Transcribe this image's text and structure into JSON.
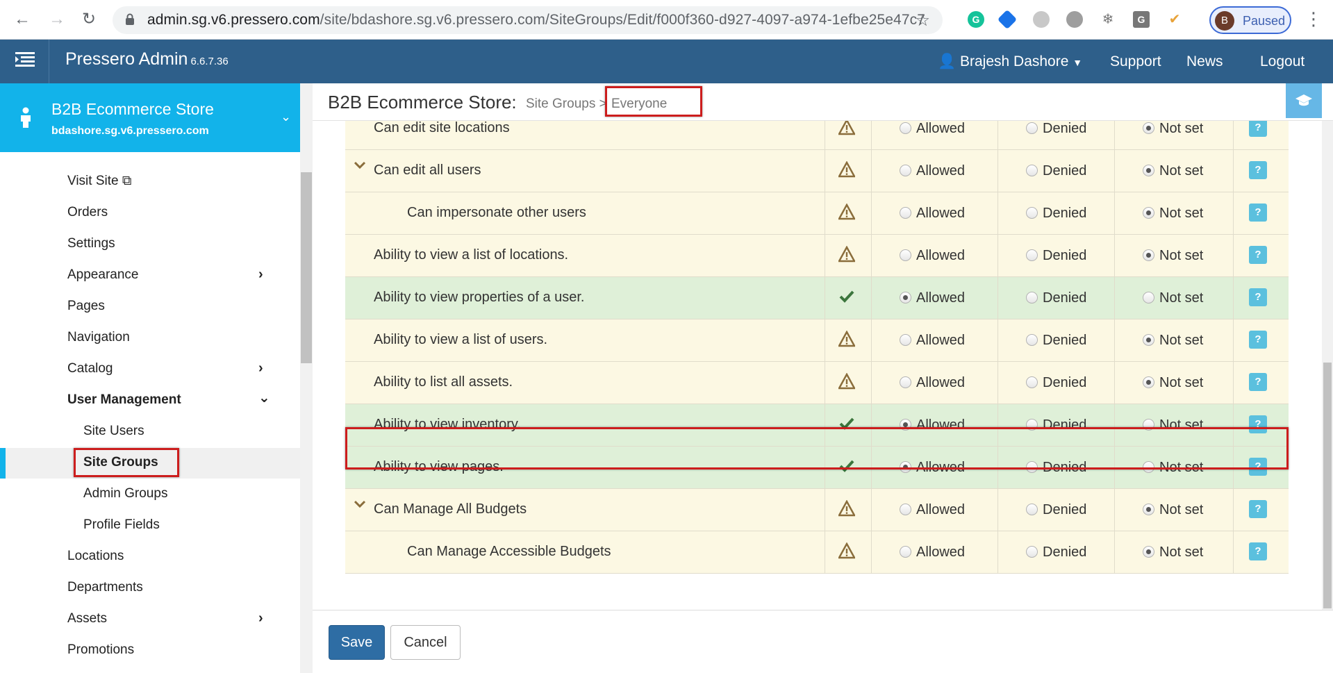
{
  "browser": {
    "url_host": "admin.sg.v6.pressero.com",
    "url_path": "/site/bdashore.sg.v6.pressero.com/SiteGroups/Edit/f000f360-d927-4097-a974-1efbe25e47c7",
    "profile_initial": "B",
    "profile_status": "Paused"
  },
  "header": {
    "brand": "Pressero Admin",
    "version": "6.6.7.36",
    "user": "Brajesh Dashore",
    "nav": [
      "Support",
      "News",
      "Logout"
    ]
  },
  "store": {
    "name": "B2B Ecommerce Store",
    "domain": "bdashore.sg.v6.pressero.com"
  },
  "sidebar": {
    "items": [
      {
        "label": "Visit Site"
      },
      {
        "label": "Orders"
      },
      {
        "label": "Settings"
      },
      {
        "label": "Appearance"
      },
      {
        "label": "Pages"
      },
      {
        "label": "Navigation"
      },
      {
        "label": "Catalog"
      },
      {
        "label": "User Management"
      },
      {
        "label": "Site Users"
      },
      {
        "label": "Site Groups"
      },
      {
        "label": "Admin Groups"
      },
      {
        "label": "Profile Fields"
      },
      {
        "label": "Locations"
      },
      {
        "label": "Departments"
      },
      {
        "label": "Assets"
      },
      {
        "label": "Promotions"
      }
    ]
  },
  "content": {
    "title": "B2B Ecommerce Store:",
    "breadcrumb": "Site Groups",
    "separator": ">",
    "current": "Everyone"
  },
  "options": {
    "allowed": "Allowed",
    "denied": "Denied",
    "notset": "Not set",
    "help": "?"
  },
  "permissions": [
    {
      "label": "Can edit site locations",
      "state": "notset",
      "status": "warn"
    },
    {
      "label": "Can edit all users",
      "state": "notset",
      "status": "warn"
    },
    {
      "label": "Can impersonate other users",
      "state": "notset",
      "status": "warn"
    },
    {
      "label": "Ability to view a list of locations.",
      "state": "notset",
      "status": "warn"
    },
    {
      "label": "Ability to view properties of a user.",
      "state": "allowed",
      "status": "ok"
    },
    {
      "label": "Ability to view a list of users.",
      "state": "notset",
      "status": "warn"
    },
    {
      "label": "Ability to list all assets.",
      "state": "notset",
      "status": "warn"
    },
    {
      "label": "Ability to view inventory.",
      "state": "allowed",
      "status": "ok"
    },
    {
      "label": "Ability to view pages.",
      "state": "allowed",
      "status": "ok"
    },
    {
      "label": "Can Manage All Budgets",
      "state": "notset",
      "status": "warn"
    },
    {
      "label": "Can Manage Accessible Budgets",
      "state": "notset",
      "status": "warn"
    }
  ],
  "footer": {
    "save": "Save",
    "cancel": "Cancel"
  },
  "colors": {
    "warn_row": "#fcf8e3",
    "ok_row": "#dff0d8",
    "header": "#2e5f8a",
    "store": "#12b3ea",
    "highlight": "#cc1d1d"
  }
}
